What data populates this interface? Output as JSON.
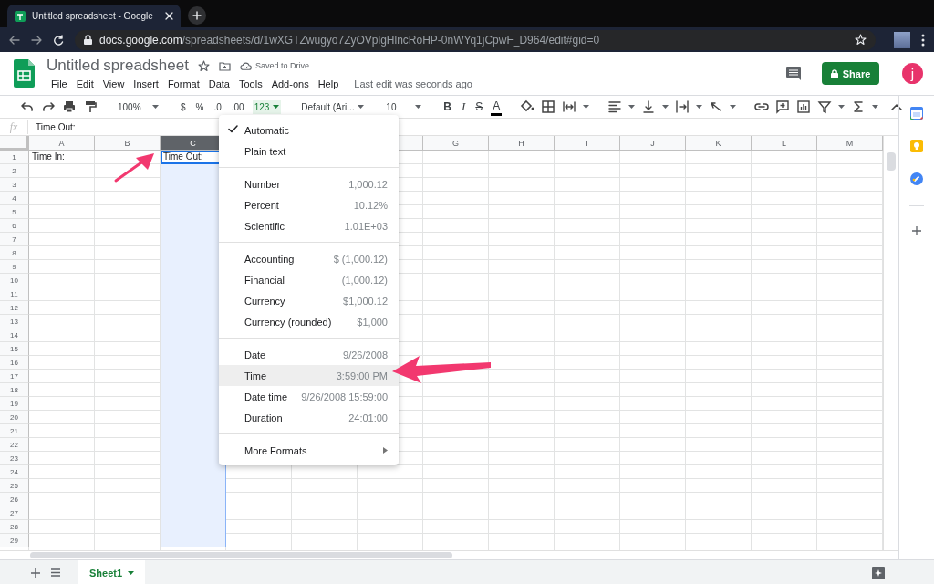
{
  "browser": {
    "tab": {
      "title": "Untitled spreadsheet - Google"
    },
    "url": {
      "host": "docs.google.com",
      "path": "/spreadsheets/d/1wXGTZwugyo7ZyOVplgHlncRoHP-0nWYq1jCpwF_D964/edit#gid=0"
    }
  },
  "document": {
    "title": "Untitled spreadsheet",
    "save_status": "Saved to Drive",
    "last_edit": "Last edit was seconds ago",
    "share": "Share",
    "avatar": "j"
  },
  "menu_bar": [
    "File",
    "Edit",
    "View",
    "Insert",
    "Format",
    "Data",
    "Tools",
    "Add-ons",
    "Help"
  ],
  "toolbar": {
    "zoom": "100%",
    "currency": "$",
    "percent": "%",
    "decrease_decimals": ".0",
    "increase_decimals": ".00",
    "number_format": {
      "label": "123",
      "active": true
    },
    "font": "Default (Ari...",
    "font_size": "10",
    "bold": "B",
    "italic": "I",
    "strikethrough": "S",
    "text_color": "A"
  },
  "formula_bar": {
    "label": "fx",
    "value": "Time Out:"
  },
  "columns": [
    {
      "label": "A",
      "selected": false
    },
    {
      "label": "B",
      "selected": false
    },
    {
      "label": "C",
      "selected": true
    },
    {},
    {},
    {
      "kind": "blank"
    },
    {
      "label": "G",
      "selected": false
    },
    {
      "label": "H",
      "selected": false
    },
    {
      "label": "I",
      "selected": false
    },
    {
      "label": "J",
      "selected": false
    },
    {
      "label": "K",
      "selected": false
    },
    {
      "label": "L",
      "selected": false
    },
    {
      "label": "M",
      "selected": false
    }
  ],
  "rows": [
    {
      "header": "1",
      "cells": [
        {
          "text": "Time In:",
          "active": false
        },
        {},
        {
          "text": "Time Out:",
          "active": true
        }
      ]
    },
    {
      "header": "2"
    },
    {
      "header": "3"
    },
    {
      "header": "4"
    },
    {
      "header": "5"
    },
    {
      "header": "6"
    },
    {
      "header": "7"
    },
    {
      "header": "8"
    },
    {
      "header": "9"
    },
    {
      "header": "10"
    },
    {
      "header": "11"
    },
    {
      "header": "12"
    },
    {
      "header": "13"
    },
    {
      "header": "14"
    },
    {
      "header": "15"
    },
    {
      "header": "16"
    },
    {
      "header": "17"
    },
    {
      "header": "18"
    },
    {
      "header": "19"
    },
    {
      "header": "20"
    },
    {
      "header": "21"
    },
    {
      "header": "22"
    },
    {
      "header": "23"
    },
    {
      "header": "24"
    },
    {
      "header": "25"
    },
    {
      "header": "26"
    },
    {
      "header": "27"
    },
    {
      "header": "28"
    },
    {
      "header": "29"
    }
  ],
  "format_menu": {
    "groups": [
      [
        {
          "kind": "option",
          "label": "Automatic",
          "checked": true,
          "selected": false
        },
        {
          "kind": "option",
          "label": "Plain text",
          "checked": false,
          "selected": false
        }
      ],
      [
        {
          "kind": "option",
          "label": "Number",
          "sample": "1,000.12",
          "checked": false,
          "selected": false
        },
        {
          "kind": "option",
          "label": "Percent",
          "sample": "10.12%",
          "checked": false,
          "selected": false
        },
        {
          "kind": "option",
          "label": "Scientific",
          "sample": "1.01E+03",
          "checked": false,
          "selected": false
        }
      ],
      [
        {
          "kind": "option",
          "label": "Accounting",
          "sample": "$ (1,000.12)",
          "checked": false,
          "selected": false
        },
        {
          "kind": "option",
          "label": "Financial",
          "sample": "(1,000.12)",
          "checked": false,
          "selected": false
        },
        {
          "kind": "option",
          "label": "Currency",
          "sample": "$1,000.12",
          "checked": false,
          "selected": false
        },
        {
          "kind": "option",
          "label": "Currency (rounded)",
          "sample": "$1,000",
          "checked": false,
          "selected": false
        }
      ],
      [
        {
          "kind": "option",
          "label": "Date",
          "sample": "9/26/2008",
          "checked": false,
          "selected": false
        },
        {
          "kind": "option",
          "label": "Time",
          "sample": "3:59:00 PM",
          "checked": false,
          "selected": true
        },
        {
          "kind": "option",
          "label": "Date time",
          "sample": "9/26/2008 15:59:00",
          "checked": false,
          "selected": false
        },
        {
          "kind": "option",
          "label": "Duration",
          "sample": "24:01:00",
          "checked": false,
          "selected": false
        }
      ],
      [
        {
          "kind": "submenu",
          "label": "More Formats",
          "checked": false,
          "selected": false
        }
      ]
    ]
  },
  "sheet_tabs": [
    {
      "label": "Sheet1",
      "selected": true
    }
  ]
}
